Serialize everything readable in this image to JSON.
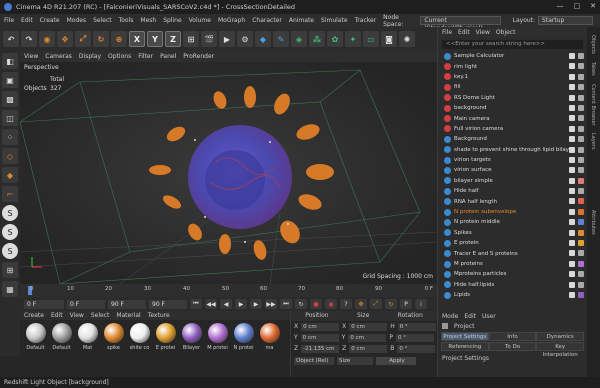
{
  "window": {
    "title": "Cinema 4D R21.207 (RC) - [FalconieriVisuals_SARSCoV2.c4d *] - CrossSectionDetailed",
    "controls": [
      "—",
      "□",
      "✕"
    ]
  },
  "menubar": {
    "items": [
      "File",
      "Edit",
      "Create",
      "Modes",
      "Select",
      "Tools",
      "Mesh",
      "Spline",
      "Volume",
      "MoGraph",
      "Character",
      "Animate",
      "Simulate",
      "Tracker"
    ],
    "node_space_label": "Node Space:",
    "node_space_value": "Current (Standard/Physical)",
    "layout_label": "Layout:",
    "layout_value": "Startup"
  },
  "toolbar": {
    "xyz": [
      "X",
      "Y",
      "Z"
    ]
  },
  "viewport": {
    "menu": [
      "View",
      "Cameras",
      "Display",
      "Options",
      "Filter",
      "Panel",
      "ProRender"
    ],
    "camera": "Perspective",
    "stats_header": "Total",
    "stats_label": "Objects",
    "stats_value": "327",
    "grid_spacing": "Grid Spacing : 1000 cm"
  },
  "timeline": {
    "ticks": [
      "0",
      "10",
      "20",
      "30",
      "40",
      "50",
      "60",
      "70",
      "80",
      "90"
    ],
    "frame_end": "0 F"
  },
  "playbar": {
    "start": "0 F",
    "current": "0 F",
    "end": "90 F",
    "end2": "90 F"
  },
  "materials": {
    "menu": [
      "Create",
      "Edit",
      "View",
      "Select",
      "Material",
      "Texture"
    ],
    "items": [
      {
        "name": "Default",
        "color": "#c8c8c8"
      },
      {
        "name": "Default",
        "color": "#a0a0a0"
      },
      {
        "name": "Mat",
        "color": "#e0e0e0"
      },
      {
        "name": "spike",
        "color": "#e08a30"
      },
      {
        "name": "shite co",
        "color": "#f0f0f0"
      },
      {
        "name": "E protei",
        "color": "#e0a030"
      },
      {
        "name": "Bilayer",
        "color": "#9060c0"
      },
      {
        "name": "M protei",
        "color": "#b070d0"
      },
      {
        "name": "N protei",
        "color": "#6080d0"
      },
      {
        "name": "ma",
        "color": "#e06a30"
      }
    ]
  },
  "coordinates": {
    "headers": [
      "Position",
      "Size",
      "Rotation"
    ],
    "rows": [
      {
        "a": "X",
        "av": "0 cm",
        "b": "X",
        "bv": "0 cm",
        "c": "H",
        "cv": "0 °"
      },
      {
        "a": "Y",
        "av": "0 cm",
        "b": "Y",
        "bv": "0 cm",
        "c": "P",
        "cv": "0 °"
      },
      {
        "a": "Z",
        "av": "-21.135 cm",
        "b": "Z",
        "bv": "0 cm",
        "c": "B",
        "cv": "0 °"
      }
    ],
    "mode": "Object (Rel)",
    "size_mode": "Size",
    "apply": "Apply"
  },
  "objects": {
    "menu": [
      "File",
      "Edit",
      "View",
      "Object"
    ],
    "search_placeholder": "<<Enter your search string here>>",
    "items": [
      {
        "name": "Sample Calculator",
        "icon": "#3a8ad0",
        "tag": "#aaaaaa"
      },
      {
        "name": "rim light",
        "icon": "#d04040",
        "tag": "#aaaaaa"
      },
      {
        "name": "key.1",
        "icon": "#d04040",
        "tag": "#aaaaaa"
      },
      {
        "name": "fill",
        "icon": "#d04040",
        "tag": "#aaaaaa"
      },
      {
        "name": "RS Dome Light",
        "icon": "#d04040",
        "tag": "#aaaaaa"
      },
      {
        "name": "background",
        "icon": "#d04040",
        "tag": "#aaaaaa"
      },
      {
        "name": "Main camera",
        "icon": "#d04040",
        "tag": "#aaaaaa"
      },
      {
        "name": "Full virion camera",
        "icon": "#d04040",
        "tag": "#aaaaaa"
      },
      {
        "name": "Background",
        "icon": "#3a8ad0",
        "tag": "#aaaaaa"
      },
      {
        "name": "shade to prevent shine through lipid bilayer",
        "icon": "#3a8ad0",
        "tag": "#aaaaaa"
      },
      {
        "name": "virion targets",
        "icon": "#3a8ad0",
        "tag": "#aaaaaa"
      },
      {
        "name": "virion surface",
        "icon": "#3a8ad0",
        "tag": "#aaaaaa"
      },
      {
        "name": "bilayer simple",
        "icon": "#3a8ad0",
        "tag": "#e07a7a"
      },
      {
        "name": "Hide half",
        "icon": "#3a8ad0",
        "tag": "#aaaaaa"
      },
      {
        "name": "RNA half length",
        "icon": "#3a8ad0",
        "tag": "#e06050"
      },
      {
        "name": "N protein subenvelope",
        "icon": "#3a8ad0",
        "tag": "#e07030",
        "highlight": true
      },
      {
        "name": "N protein middle",
        "icon": "#3a8ad0",
        "tag": "#6080d0"
      },
      {
        "name": "Spikes",
        "icon": "#3a8ad0",
        "tag": "#e08a30"
      },
      {
        "name": "E protein",
        "icon": "#3a8ad0",
        "tag": "#e0a030"
      },
      {
        "name": "Tracer E and S proteins",
        "icon": "#3a8ad0",
        "tag": "#aaaaaa"
      },
      {
        "name": "M proteins",
        "icon": "#3a8ad0",
        "tag": "#b070d0"
      },
      {
        "name": "Mproteins particles",
        "icon": "#3a8ad0",
        "tag": "#aaaaaa"
      },
      {
        "name": "Hide half.lipids",
        "icon": "#3a8ad0",
        "tag": "#aaaaaa"
      },
      {
        "name": "Lipids",
        "icon": "#3a8ad0",
        "tag": "#9060c0"
      }
    ]
  },
  "attributes": {
    "menu": [
      "Mode",
      "Edit",
      "User"
    ],
    "title": "Project",
    "tabs": [
      "Project Settings",
      "Info",
      "Dynamics"
    ],
    "tabs2": [
      "Referencing",
      "To Do",
      "Key Interpolation"
    ],
    "section": "Project Settings"
  },
  "sidetabs": [
    "Objects",
    "Takes",
    "Content Browser",
    "Layers",
    "Attributes"
  ],
  "status": {
    "text": "Redshift Light Object [background]"
  }
}
